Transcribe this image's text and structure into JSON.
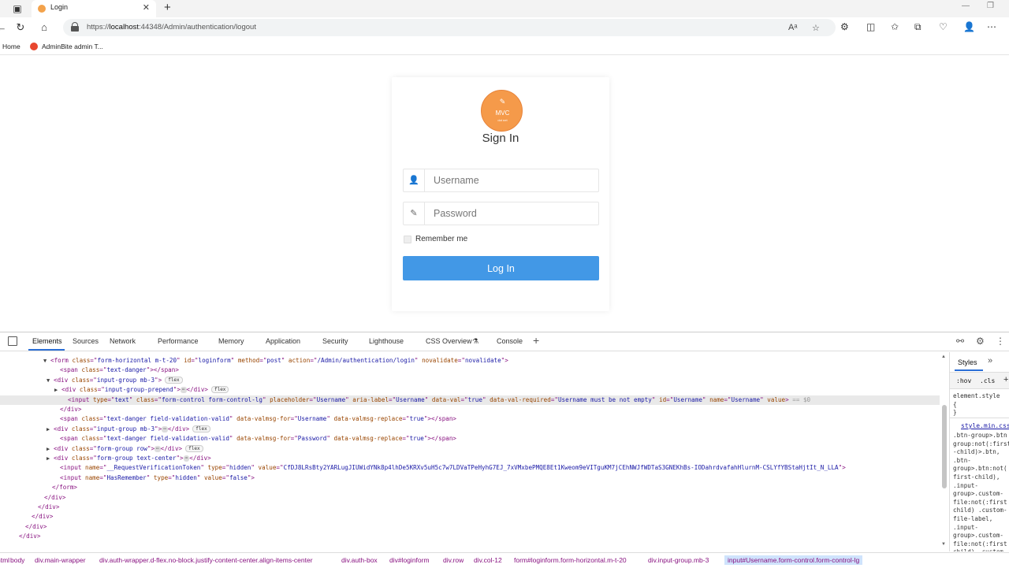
{
  "browser": {
    "tab_title": "Login",
    "url_prefix": "https://",
    "url_host": "localhost",
    "url_rest": ":44348/Admin/authentication/logout",
    "bookmarks": [
      "Home",
      "AdminBite admin T..."
    ]
  },
  "login": {
    "logo_text": "MVC",
    "logo_sub": "dot net",
    "title": "Sign In",
    "username_placeholder": "Username",
    "password_placeholder": "Password",
    "remember_label": "Remember me",
    "login_button": "Log In"
  },
  "devtools": {
    "tabs": [
      "Elements",
      "Sources",
      "Network",
      "Performance",
      "Memory",
      "Application",
      "Security",
      "Lighthouse",
      "CSS Overview",
      "Console"
    ],
    "active_tab": "Elements",
    "styles_tab": "Styles",
    "hov": ":hov",
    "cls": ".cls",
    "element_style_lines": [
      "element.style",
      "{",
      "}"
    ],
    "stylesheet_link": "style.min.css",
    "style_rule_lines": [
      ".btn-group>.btn",
      "group:not(:first",
      "-child)>.btn,",
      ".btn-",
      "group>.btn:not(",
      "first-child),",
      ".input-",
      "group>.custom-",
      "file:not(:first",
      "child) .custom-",
      "file-label,",
      ".input-",
      "group>.custom-",
      "file:not(:first",
      "child) .custom-",
      "file-"
    ],
    "code_lines": [
      {
        "indent": 64,
        "tri": "▼",
        "parts": [
          [
            "tag",
            "<form "
          ],
          [
            "attr",
            "class"
          ],
          [
            "tag",
            "=\""
          ],
          [
            "val",
            "form-horizontal m-t-20"
          ],
          [
            "tag",
            "\" "
          ],
          [
            "attr",
            "id"
          ],
          [
            "tag",
            "=\""
          ],
          [
            "val",
            "loginform"
          ],
          [
            "tag",
            "\" "
          ],
          [
            "attr",
            "method"
          ],
          [
            "tag",
            "=\""
          ],
          [
            "val",
            "post"
          ],
          [
            "tag",
            "\" "
          ],
          [
            "attr",
            "action"
          ],
          [
            "tag",
            "=\""
          ],
          [
            "val",
            "/Admin/authentication/login"
          ],
          [
            "tag",
            "\" "
          ],
          [
            "attr",
            "novalidate"
          ],
          [
            "tag",
            "=\""
          ],
          [
            "val",
            "novalidate"
          ],
          [
            "tag",
            "\">"
          ]
        ]
      },
      {
        "indent": 76,
        "tri": "",
        "parts": [
          [
            "tag",
            "<span "
          ],
          [
            "attr",
            "class"
          ],
          [
            "tag",
            "=\""
          ],
          [
            "val",
            "text-danger"
          ],
          [
            "tag",
            "\"></span>"
          ]
        ]
      },
      {
        "indent": 68,
        "tri": "▼",
        "parts": [
          [
            "tag",
            "<div "
          ],
          [
            "attr",
            "class"
          ],
          [
            "tag",
            "=\""
          ],
          [
            "val",
            "input-group mb-3"
          ],
          [
            "tag",
            "\">"
          ]
        ],
        "badge": "flex"
      },
      {
        "indent": 78,
        "tri": "▶",
        "parts": [
          [
            "tag",
            "<div "
          ],
          [
            "attr",
            "class"
          ],
          [
            "tag",
            "=\""
          ],
          [
            "val",
            "input-group-prepend"
          ],
          [
            "tag",
            "\">"
          ]
        ],
        "ellipsis": true,
        "close": "</div>",
        "badge": "flex"
      },
      {
        "indent": 86,
        "tri": "",
        "selected": true,
        "parts": [
          [
            "tag",
            "<input "
          ],
          [
            "attr",
            "type"
          ],
          [
            "tag",
            "=\""
          ],
          [
            "val",
            "text"
          ],
          [
            "tag",
            "\" "
          ],
          [
            "attr",
            "class"
          ],
          [
            "tag",
            "=\""
          ],
          [
            "val",
            "form-control form-control-lg"
          ],
          [
            "tag",
            "\" "
          ],
          [
            "attr",
            "placeholder"
          ],
          [
            "tag",
            "=\""
          ],
          [
            "val",
            "Username"
          ],
          [
            "tag",
            "\" "
          ],
          [
            "attr",
            "aria-label"
          ],
          [
            "tag",
            "=\""
          ],
          [
            "val",
            "Username"
          ],
          [
            "tag",
            "\" "
          ],
          [
            "attr",
            "data-val"
          ],
          [
            "tag",
            "=\""
          ],
          [
            "val",
            "true"
          ],
          [
            "tag",
            "\" "
          ],
          [
            "attr",
            "data-val-required"
          ],
          [
            "tag",
            "=\""
          ],
          [
            "val",
            "Username must be not empty"
          ],
          [
            "tag",
            "\" "
          ],
          [
            "attr",
            "id"
          ],
          [
            "tag",
            "=\""
          ],
          [
            "val",
            "Username"
          ],
          [
            "tag",
            "\" "
          ],
          [
            "attr",
            "name"
          ],
          [
            "tag",
            "=\""
          ],
          [
            "val",
            "Username"
          ],
          [
            "tag",
            "\" "
          ],
          [
            "attr",
            "value"
          ],
          [
            "tag",
            ">"
          ],
          [
            "grey",
            " == $0"
          ]
        ]
      },
      {
        "indent": 76,
        "tri": "",
        "parts": [
          [
            "tag",
            "</div>"
          ]
        ]
      },
      {
        "indent": 76,
        "tri": "",
        "parts": [
          [
            "tag",
            "<span "
          ],
          [
            "attr",
            "class"
          ],
          [
            "tag",
            "=\""
          ],
          [
            "val",
            "text-danger field-validation-valid"
          ],
          [
            "tag",
            "\" "
          ],
          [
            "attr",
            "data-valmsg-for"
          ],
          [
            "tag",
            "=\""
          ],
          [
            "val",
            "Username"
          ],
          [
            "tag",
            "\" "
          ],
          [
            "attr",
            "data-valmsg-replace"
          ],
          [
            "tag",
            "=\""
          ],
          [
            "val",
            "true"
          ],
          [
            "tag",
            "\"></span>"
          ]
        ]
      },
      {
        "indent": 68,
        "tri": "▶",
        "parts": [
          [
            "tag",
            "<div "
          ],
          [
            "attr",
            "class"
          ],
          [
            "tag",
            "=\""
          ],
          [
            "val",
            "input-group mb-3"
          ],
          [
            "tag",
            "\">"
          ]
        ],
        "ellipsis": true,
        "close": "</div>",
        "badge": "flex"
      },
      {
        "indent": 76,
        "tri": "",
        "parts": [
          [
            "tag",
            "<span "
          ],
          [
            "attr",
            "class"
          ],
          [
            "tag",
            "=\""
          ],
          [
            "val",
            "text-danger field-validation-valid"
          ],
          [
            "tag",
            "\" "
          ],
          [
            "attr",
            "data-valmsg-for"
          ],
          [
            "tag",
            "=\""
          ],
          [
            "val",
            "Password"
          ],
          [
            "tag",
            "\" "
          ],
          [
            "attr",
            "data-valmsg-replace"
          ],
          [
            "tag",
            "=\""
          ],
          [
            "val",
            "true"
          ],
          [
            "tag",
            "\"></span>"
          ]
        ]
      },
      {
        "indent": 68,
        "tri": "▶",
        "parts": [
          [
            "tag",
            "<div "
          ],
          [
            "attr",
            "class"
          ],
          [
            "tag",
            "=\""
          ],
          [
            "val",
            "form-group row"
          ],
          [
            "tag",
            "\">"
          ]
        ],
        "ellipsis": true,
        "close": "</div>",
        "badge": "flex"
      },
      {
        "indent": 68,
        "tri": "▶",
        "parts": [
          [
            "tag",
            "<div "
          ],
          [
            "attr",
            "class"
          ],
          [
            "tag",
            "=\""
          ],
          [
            "val",
            "form-group text-center"
          ],
          [
            "tag",
            "\">"
          ]
        ],
        "ellipsis": true,
        "close": "</div>"
      },
      {
        "indent": 76,
        "tri": "",
        "parts": [
          [
            "tag",
            "<input "
          ],
          [
            "attr",
            "name"
          ],
          [
            "tag",
            "=\""
          ],
          [
            "val",
            "__RequestVerificationToken"
          ],
          [
            "tag",
            "\" "
          ],
          [
            "attr",
            "type"
          ],
          [
            "tag",
            "=\""
          ],
          [
            "val",
            "hidden"
          ],
          [
            "tag",
            "\" "
          ],
          [
            "attr",
            "value"
          ],
          [
            "tag",
            "=\""
          ],
          [
            "val",
            "CfDJ8LRsBty2YARLugJIUWidYNk8p4lhDe5KRXv5uH5c7w7LDVaTPeHyhG7EJ_7xVMxbePMQE8Et1Kweom9eVITguKM7jCEhNWJfWDTaS3GNEKhBs-IODahrdvafahHlurnM-CSLYfYBStaHjtIt_N_LLA"
          ],
          [
            "tag",
            "\">"
          ]
        ]
      },
      {
        "indent": 76,
        "tri": "",
        "parts": [
          [
            "tag",
            "<input "
          ],
          [
            "attr",
            "name"
          ],
          [
            "tag",
            "=\""
          ],
          [
            "val",
            "HasRemember"
          ],
          [
            "tag",
            "\" "
          ],
          [
            "attr",
            "type"
          ],
          [
            "tag",
            "=\""
          ],
          [
            "val",
            "hidden"
          ],
          [
            "tag",
            "\" "
          ],
          [
            "attr",
            "value"
          ],
          [
            "tag",
            "=\""
          ],
          [
            "val",
            "false"
          ],
          [
            "tag",
            "\">"
          ]
        ]
      },
      {
        "indent": 66,
        "tri": "",
        "parts": [
          [
            "tag",
            "</form>"
          ]
        ]
      },
      {
        "indent": 56,
        "tri": "",
        "parts": [
          [
            "tag",
            "</div>"
          ]
        ]
      },
      {
        "indent": 48,
        "tri": "",
        "parts": [
          [
            "tag",
            "</div>"
          ]
        ]
      },
      {
        "indent": 40,
        "tri": "",
        "parts": [
          [
            "tag",
            "</div>"
          ]
        ]
      },
      {
        "indent": 32,
        "tri": "",
        "parts": [
          [
            "tag",
            "</div>"
          ]
        ]
      },
      {
        "indent": 24,
        "tri": "",
        "parts": [
          [
            "tag",
            "</div>"
          ]
        ]
      }
    ],
    "breadcrumbs": [
      "html",
      "body",
      "div.main-wrapper",
      "div.auth-wrapper.d-flex.no-block.justify-content-center.align-items-center",
      "div.auth-box",
      "div#loginform",
      "div.row",
      "div.col-12",
      "form#loginform.form-horizontal.m-t-20",
      "div.input-group.mb-3",
      "input#Username.form-control.form-control-lg"
    ]
  }
}
